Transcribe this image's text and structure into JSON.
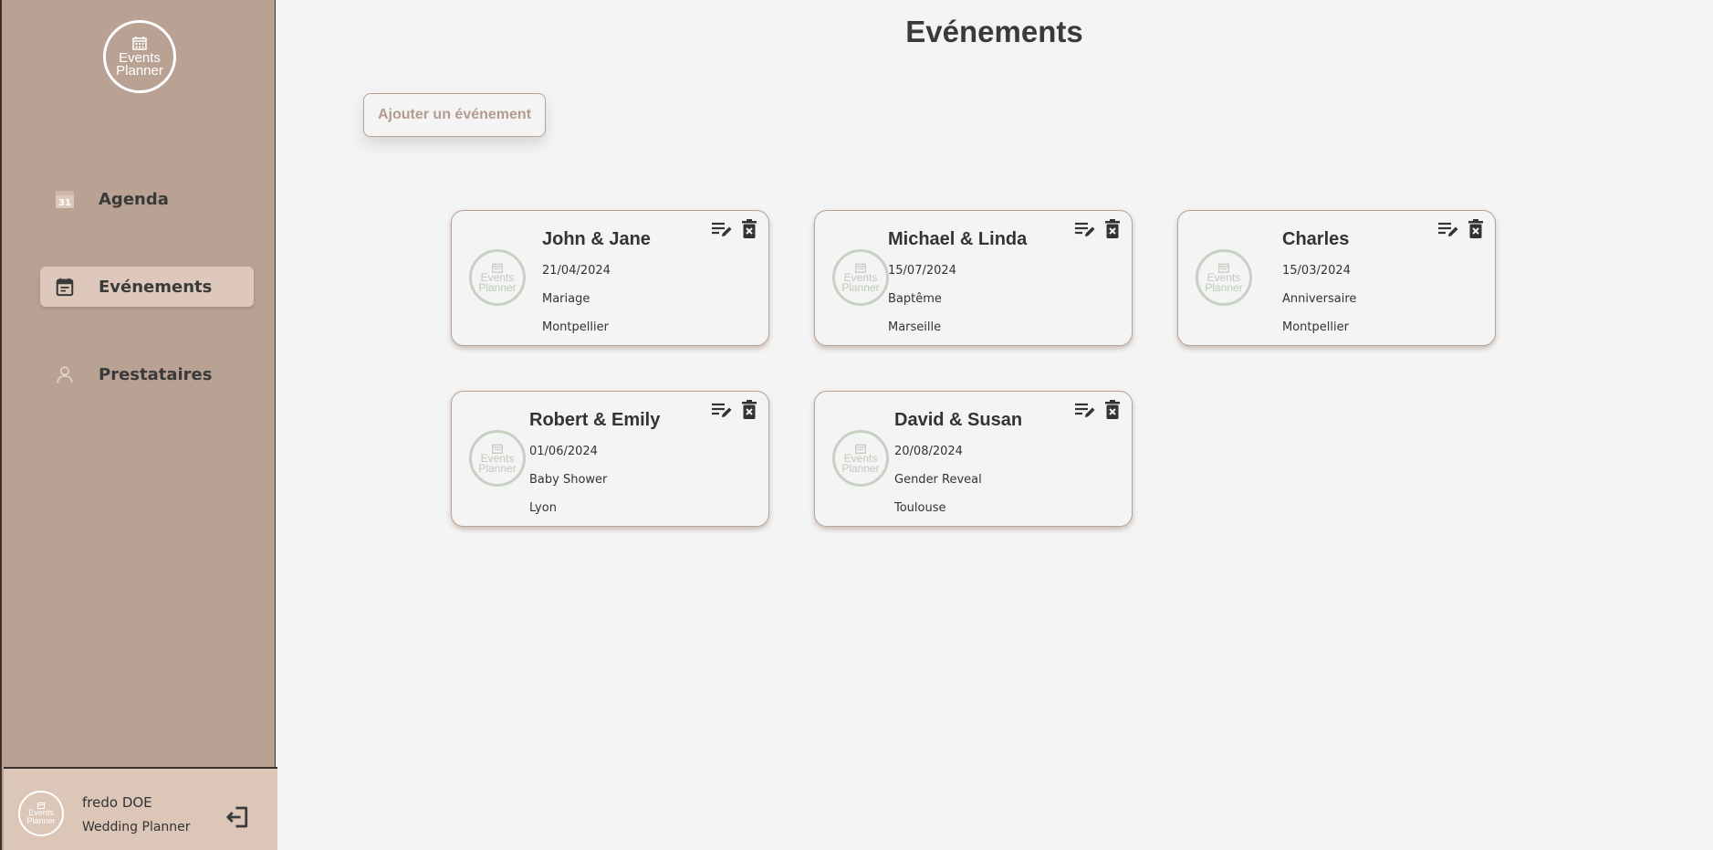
{
  "brand": {
    "line1": "Events",
    "line2": "Planner"
  },
  "nav": [
    {
      "label": "Agenda",
      "icon": "calendar-31-icon",
      "active": false
    },
    {
      "label": "Evénements",
      "icon": "event-calendar-icon",
      "active": true
    },
    {
      "label": "Prestataires",
      "icon": "person-icon",
      "active": false
    }
  ],
  "user": {
    "name": "fredo DOE",
    "role": "Wedding Planner"
  },
  "page": {
    "title": "Evénements",
    "add_button": "Ajouter un événement"
  },
  "events": [
    {
      "name": "John & Jane",
      "date": "21/04/2024",
      "type": "Mariage",
      "city": "Montpellier"
    },
    {
      "name": "Michael & Linda",
      "date": "15/07/2024",
      "type": "Baptême",
      "city": "Marseille"
    },
    {
      "name": "Charles",
      "date": "15/03/2024",
      "type": "Anniversaire",
      "city": "Montpellier"
    },
    {
      "name": "Robert & Emily",
      "date": "01/06/2024",
      "type": "Baby Shower",
      "city": "Lyon"
    },
    {
      "name": "David & Susan",
      "date": "20/08/2024",
      "type": "Gender Reveal",
      "city": "Toulouse"
    }
  ],
  "colors": {
    "sidebar": "#b9a293",
    "active_nav": "#ddc8bb",
    "user_box": "#dcc6b8",
    "accent_text": "#b39c8f",
    "background": "#f4f4f4"
  }
}
